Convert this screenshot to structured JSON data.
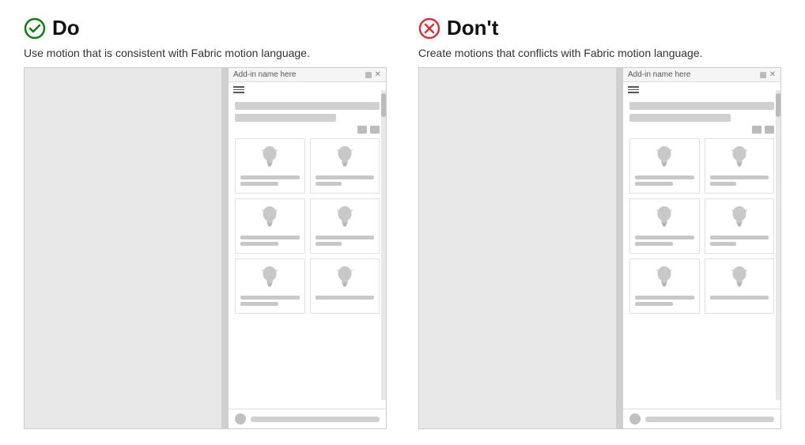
{
  "do_panel": {
    "title": "Do",
    "description": "Use motion that is consistent with Fabric motion language.",
    "taskpane_title": "Add-in name here",
    "cards": [
      {
        "id": 1
      },
      {
        "id": 2
      },
      {
        "id": 3
      },
      {
        "id": 4
      },
      {
        "id": 5
      },
      {
        "id": 6
      }
    ]
  },
  "dont_panel": {
    "title": "Don't",
    "description": "Create motions that conflicts with Fabric motion language.",
    "taskpane_title": "Add-in name here",
    "cards": [
      {
        "id": 1
      },
      {
        "id": 2
      },
      {
        "id": 3
      },
      {
        "id": 4
      },
      {
        "id": 5
      },
      {
        "id": 6
      }
    ]
  },
  "colors": {
    "do_green": "#107c10",
    "dont_red": "#d13438"
  }
}
